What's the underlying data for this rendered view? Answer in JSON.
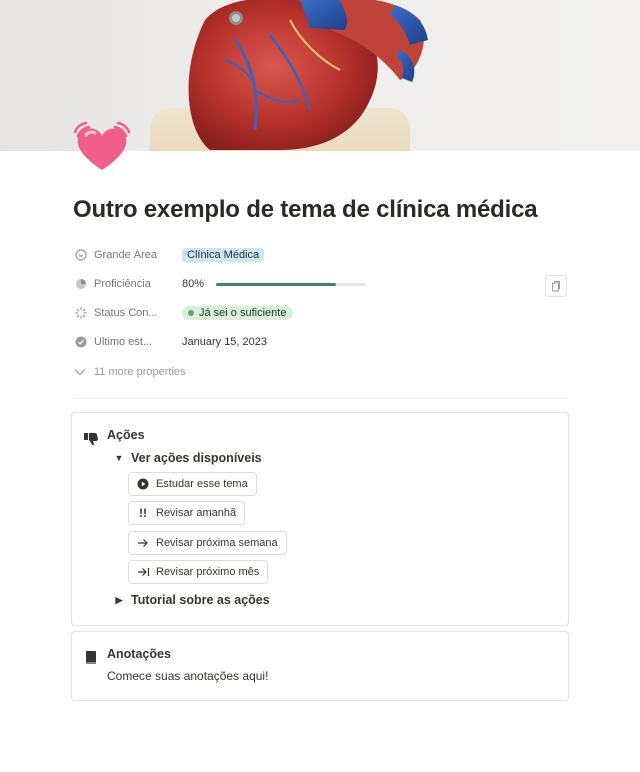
{
  "page": {
    "title": "Outro exemplo de tema de clínica médica",
    "icon": "beating-heart-emoji",
    "cover": "anatomical-heart-model-photo"
  },
  "properties": [
    {
      "name": "Grande Área",
      "icon": "target-icon",
      "value": "Clínica Médica",
      "type": "select",
      "color": "#d3e5ef"
    },
    {
      "name": "Proficiência",
      "icon": "pie-icon",
      "value": "80%",
      "type": "progress",
      "progress": 0.8,
      "color": "#448361"
    },
    {
      "name": "Status Con...",
      "icon": "loading-icon",
      "value": "Já sei o suficiente",
      "type": "status",
      "color": "#dbeddb"
    },
    {
      "name": "Último est...",
      "icon": "check-circle-icon",
      "value": "January 15, 2023",
      "type": "date"
    }
  ],
  "more_properties": "11 more properties",
  "actions_callout": {
    "title": "Ações",
    "toggle_open": "Ver ações disponíveis",
    "buttons": [
      {
        "label": "Estudar esse tema",
        "icon": "play-circle-icon"
      },
      {
        "label": "Revisar amanhã",
        "icon": "double-exclamation-icon"
      },
      {
        "label": "Revisar próxima semana",
        "icon": "arrow-right-icon"
      },
      {
        "label": "Revisar próximo mês",
        "icon": "arrow-to-bar-icon"
      }
    ],
    "toggle_closed": "Tutorial sobre as ações"
  },
  "notes_callout": {
    "title": "Anotações",
    "body": "Comece suas anotações aqui!"
  }
}
